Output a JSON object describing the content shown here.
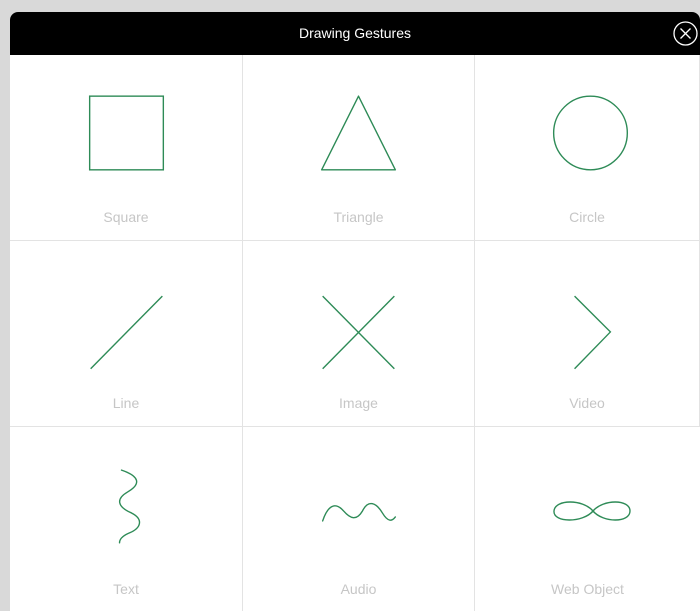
{
  "dialog": {
    "title": "Drawing Gestures",
    "close_icon": "close-circle-icon"
  },
  "accent_color": "#2e8b57",
  "label_color": "#c6c6c6",
  "gestures": [
    {
      "label": "Square",
      "icon": "square-gesture-icon"
    },
    {
      "label": "Triangle",
      "icon": "triangle-gesture-icon"
    },
    {
      "label": "Circle",
      "icon": "circle-gesture-icon"
    },
    {
      "label": "Line",
      "icon": "line-gesture-icon"
    },
    {
      "label": "Image",
      "icon": "x-gesture-icon"
    },
    {
      "label": "Video",
      "icon": "chevron-gesture-icon"
    },
    {
      "label": "Text",
      "icon": "vertical-squiggle-gesture-icon"
    },
    {
      "label": "Audio",
      "icon": "wave-gesture-icon"
    },
    {
      "label": "Web Object",
      "icon": "infinity-gesture-icon"
    }
  ]
}
